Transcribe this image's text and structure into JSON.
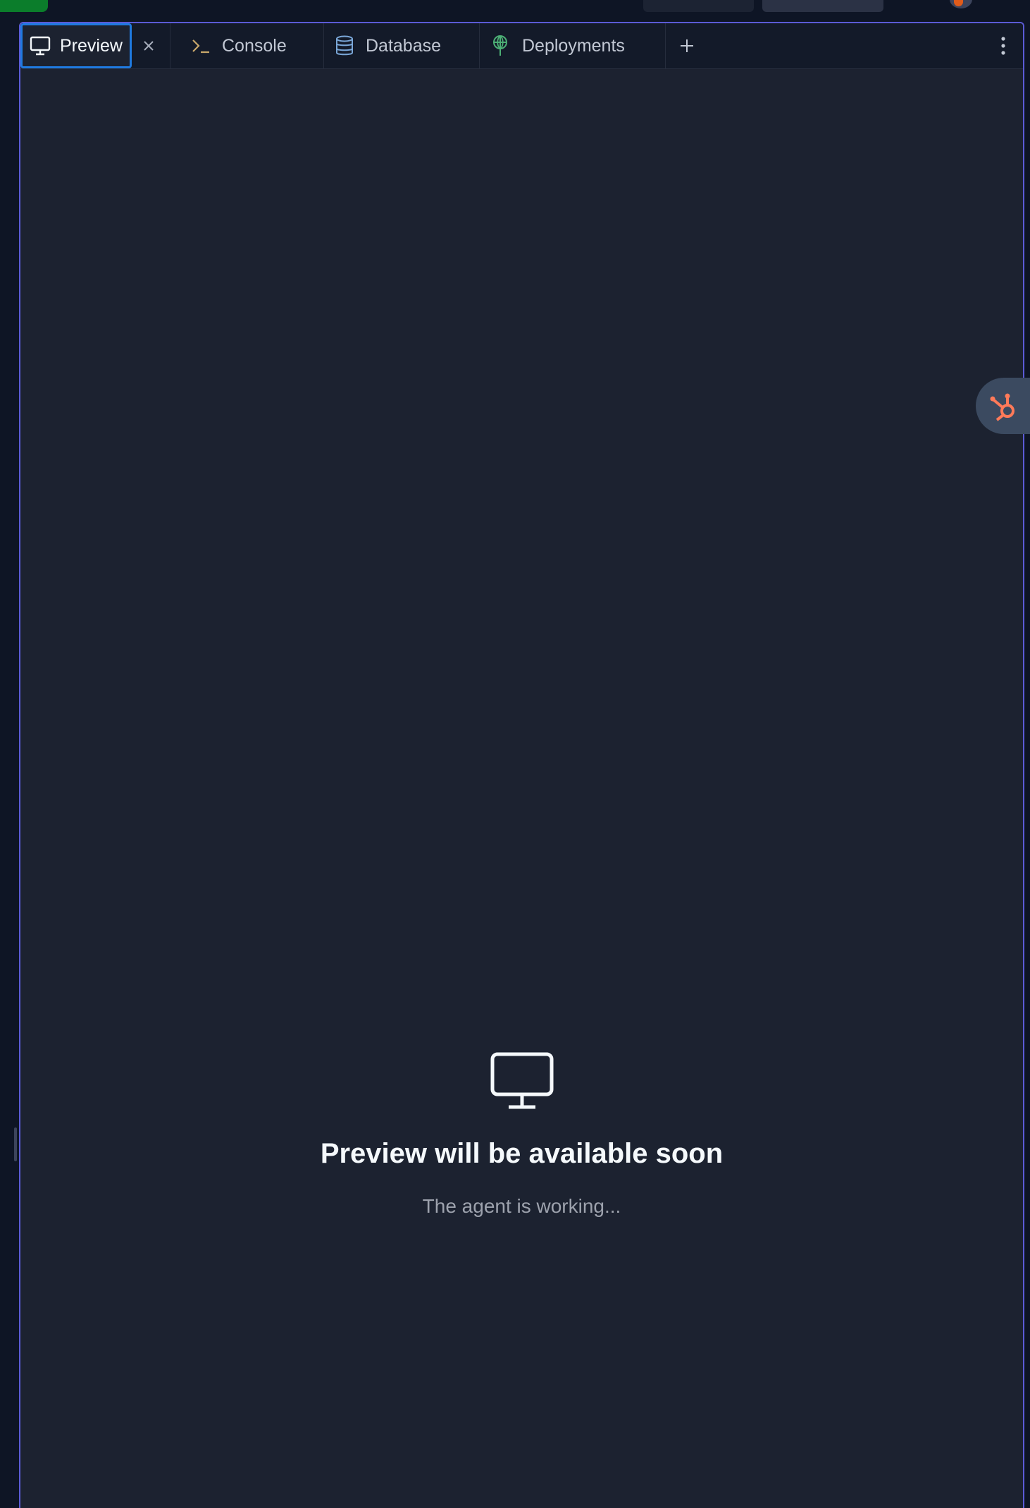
{
  "tabs": {
    "preview": {
      "label": "Preview",
      "icon": "monitor-icon",
      "active": true
    },
    "console": {
      "label": "Console",
      "icon": "terminal-icon"
    },
    "database": {
      "label": "Database",
      "icon": "database-icon"
    },
    "deployments": {
      "label": "Deployments",
      "icon": "deployments-icon"
    },
    "add_tab_icon": "plus-icon",
    "more_icon": "more-vertical-icon",
    "close_icon": "close-icon"
  },
  "empty_state": {
    "icon": "monitor-icon",
    "title": "Preview will be available soon",
    "subtitle": "The agent is working..."
  },
  "widget": {
    "icon": "hubspot-icon"
  },
  "colors": {
    "accent_border": "#5b5bd6",
    "active_tab_outline": "#1f7ae0",
    "run_button": "#0b7d2b",
    "hubspot": "#ff7a59",
    "deployments_icon": "#4caf75",
    "database_icon": "#7aa7d8",
    "console_icon": "#c9a86b"
  }
}
